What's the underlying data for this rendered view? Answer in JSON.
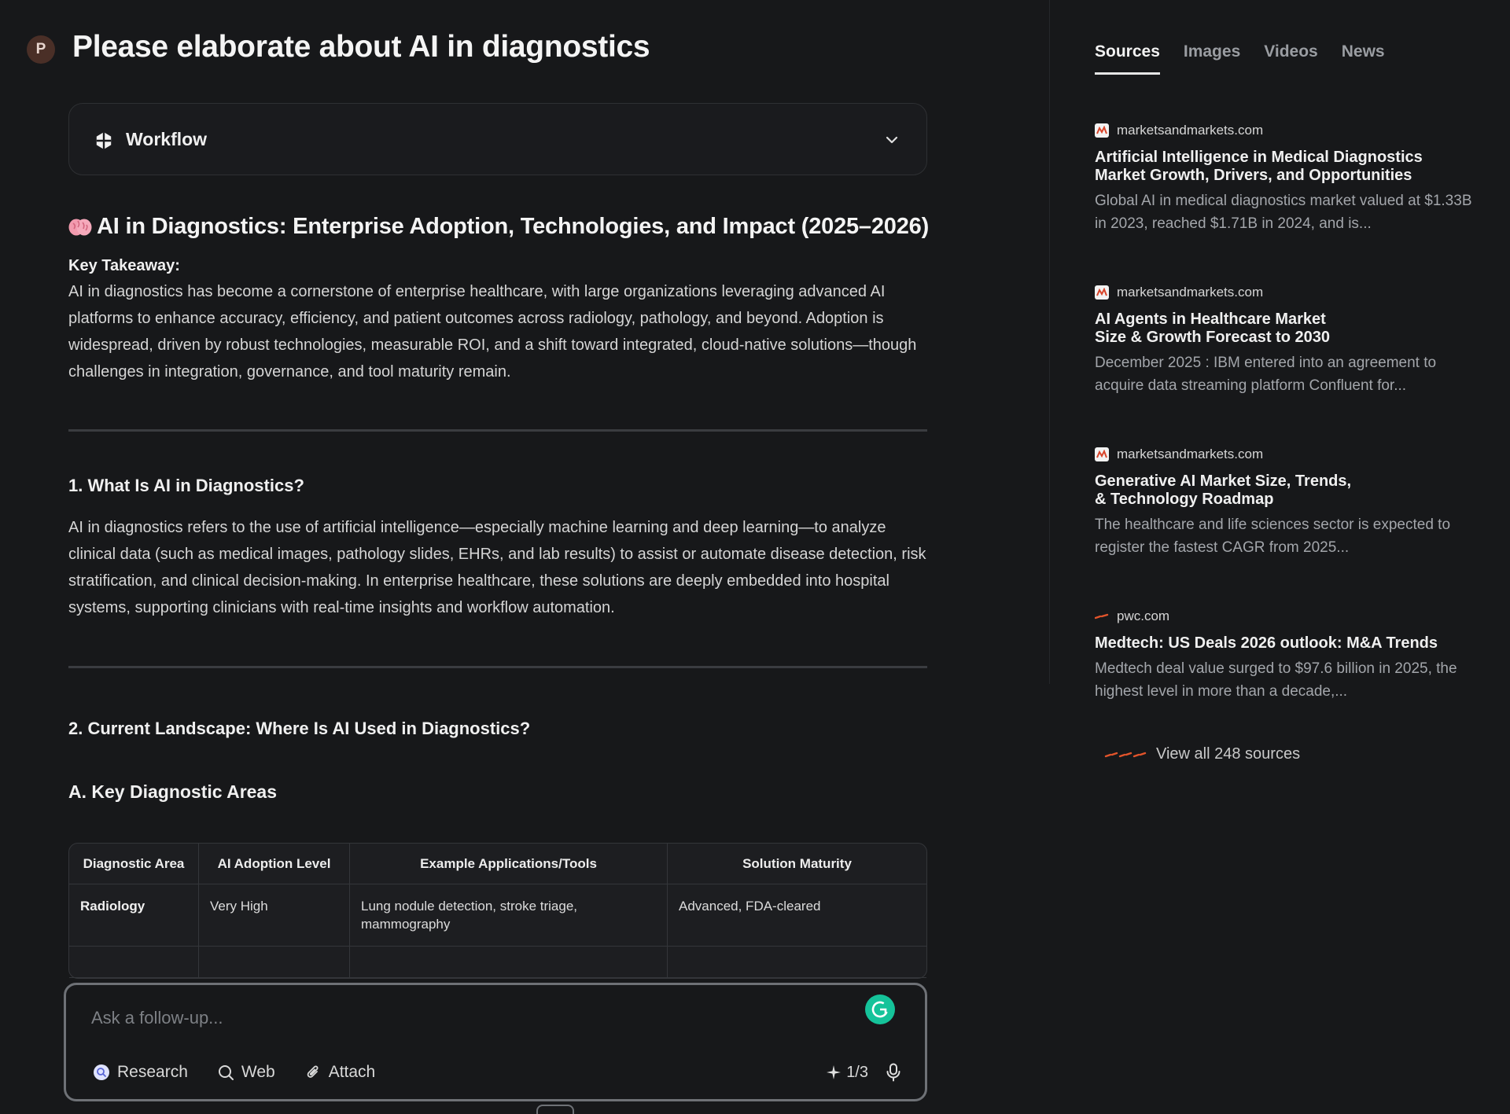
{
  "header": {
    "avatar_initial": "P",
    "title": "Please elaborate about AI in diagnostics"
  },
  "workflow": {
    "label": "Workflow",
    "icon": "workflow-icon"
  },
  "answer": {
    "heading_emoji": "brain-icon",
    "heading": "AI in Diagnostics: Enterprise Adoption, Technologies, and Impact (2025–2026)",
    "key_takeaway_label": "Key Takeaway:",
    "key_takeaway": "AI in diagnostics has become a cornerstone of enterprise healthcare, with large organizations leveraging advanced AI platforms to enhance accuracy, efficiency, and patient outcomes across radiology, pathology, and beyond. Adoption is widespread, driven by robust technologies, measurable ROI, and a shift toward integrated, cloud-native solutions—though challenges in integration, governance, and tool maturity remain.",
    "section1_heading": "1. What Is AI in Diagnostics?",
    "section1_body": "AI in diagnostics refers to the use of artificial intelligence—especially machine learning and deep learning—to analyze clinical data (such as medical images, pathology slides, EHRs, and lab results) to assist or automate disease detection, risk stratification, and clinical decision-making. In enterprise healthcare, these solutions are deeply embedded into hospital systems, supporting clinicians with real-time insights and workflow automation.",
    "section2_heading": "2. Current Landscape: Where Is AI Used in Diagnostics?",
    "subsection_a": "A. Key Diagnostic Areas",
    "table": {
      "headers": [
        "Diagnostic Area",
        "AI Adoption Level",
        "Example Applications/Tools",
        "Solution Maturity"
      ],
      "rows": [
        [
          "Radiology",
          "Very High",
          "Lung nodule detection, stroke triage, mammography",
          "Advanced, FDA-cleared"
        ]
      ]
    }
  },
  "followup": {
    "placeholder": "Ask a follow-up...",
    "tools": [
      "Research",
      "Web",
      "Attach"
    ],
    "counter": "1/3"
  },
  "panel": {
    "tabs": [
      "Sources",
      "Images",
      "Videos",
      "News"
    ],
    "active_tab": "Sources",
    "sources": [
      {
        "domain": "marketsandmarkets.com",
        "title": "Artificial Intelligence in Medical Diagnostics Market Growth, Drivers, and Opportunities",
        "snippet": "Global AI in medical diagnostics market valued at $1.33B in 2023, reached $1.71B in 2024, and is..."
      },
      {
        "domain": "marketsandmarkets.com",
        "title": "AI Agents in Healthcare Market Size & Growth Forecast to 2030",
        "snippet": "December 2025 : IBM entered into an agreement to acquire data streaming platform Confluent for..."
      },
      {
        "domain": "marketsandmarkets.com",
        "title": "Generative AI Market Size, Trends, & Technology Roadmap",
        "snippet": "The healthcare and life sciences sector is expected to register the fastest CAGR from 2025..."
      },
      {
        "domain": "pwc.com",
        "title": "Medtech: US Deals 2026 outlook: M&A Trends",
        "snippet": "Medtech deal value surged to $97.6 billion in 2025, the highest level in more than a decade,..."
      }
    ],
    "view_all": "View all 248 sources"
  },
  "colors": {
    "background": "#17181a",
    "accent_orange": "#e2542b",
    "grammarly_green": "#15c39a"
  }
}
